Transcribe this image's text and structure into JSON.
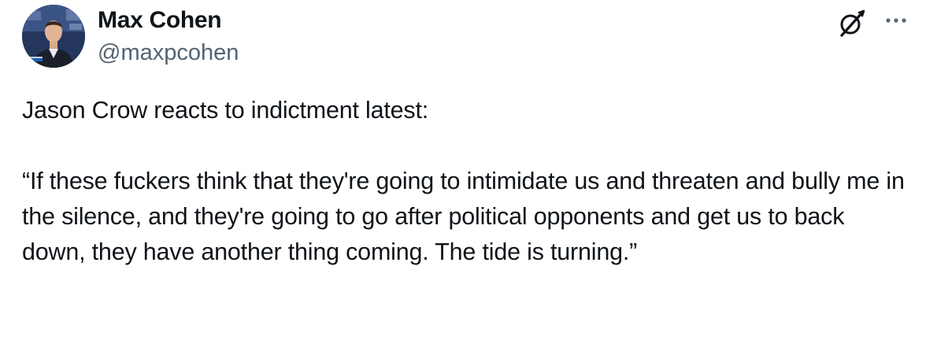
{
  "author": {
    "name": "Max Cohen",
    "handle": "@maxpcohen",
    "avatar": "avatar-photo"
  },
  "header_icons": {
    "grok": "grok-icon",
    "more": "more-options-icon"
  },
  "tweet": {
    "line1": "Jason Crow reacts to indictment latest:",
    "quote": "“If these fuckers think that they're going to intimidate us and threaten and bully me in the silence, and they're going to go after political opponents and get us to back down, they have another thing coming. The tide is turning.”"
  },
  "colors": {
    "text": "#0f1419",
    "secondary": "#536471",
    "background": "#ffffff"
  }
}
